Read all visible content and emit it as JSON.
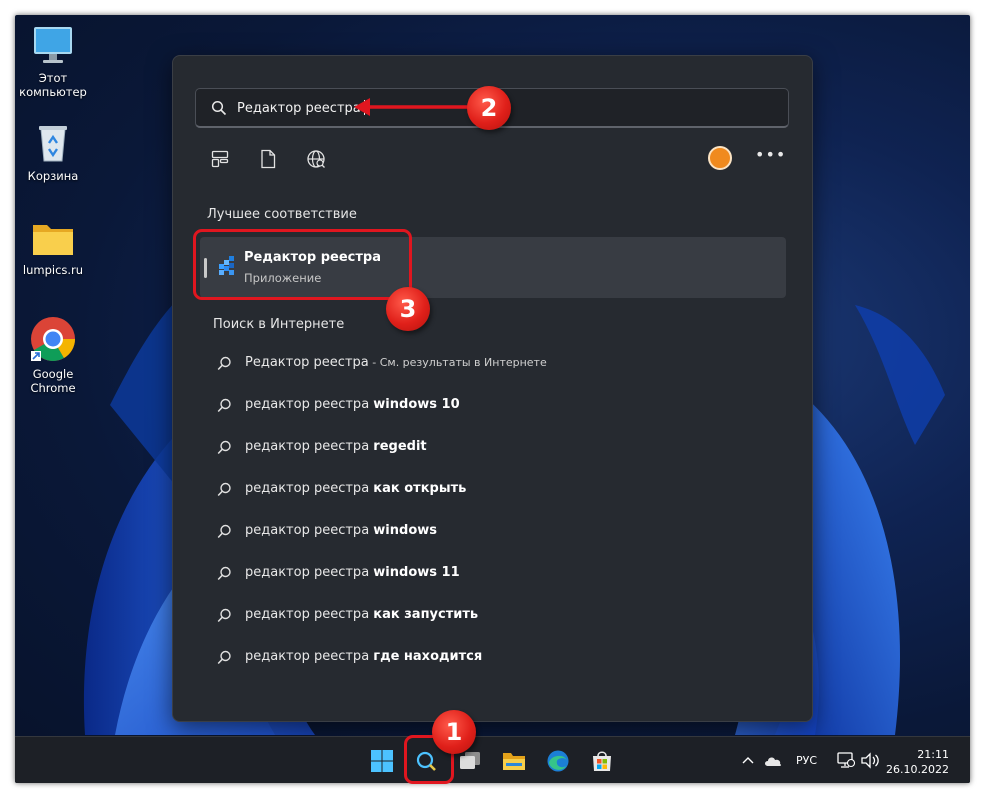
{
  "desktop": {
    "icons": [
      {
        "label_line1": "Этот",
        "label_line2": "компьютер",
        "icon": "monitor-icon"
      },
      {
        "label_line1": "Корзина",
        "label_line2": "",
        "icon": "recycle-bin-icon"
      },
      {
        "label_line1": "lumpics.ru",
        "label_line2": "",
        "icon": "folder-icon"
      },
      {
        "label_line1": "Google",
        "label_line2": "Chrome",
        "icon": "chrome-icon"
      }
    ]
  },
  "search": {
    "query": "Редактор реестра",
    "filters": [
      "apps-filter-icon",
      "documents-filter-icon",
      "web-filter-icon"
    ],
    "more_label": "•••",
    "best_match_title": "Лучшее соответствие",
    "best_match": {
      "name": "Редактор реестра",
      "type": "Приложение"
    },
    "web_title": "Поиск в Интернете",
    "web_results": [
      {
        "prefix": "Редактор реестра",
        "suffix": " - См. результаты в Интернете",
        "suffix_style": "small"
      },
      {
        "prefix": "редактор реестра ",
        "suffix": "windows 10",
        "suffix_style": "bold"
      },
      {
        "prefix": "редактор реестра ",
        "suffix": "regedit",
        "suffix_style": "bold"
      },
      {
        "prefix": "редактор реестра ",
        "suffix": "как открыть",
        "suffix_style": "bold"
      },
      {
        "prefix": "редактор реестра ",
        "suffix": "windows",
        "suffix_style": "bold"
      },
      {
        "prefix": "редактор реестра ",
        "suffix": "windows 11",
        "suffix_style": "bold"
      },
      {
        "prefix": "редактор реестра ",
        "suffix": "как запустить",
        "suffix_style": "bold"
      },
      {
        "prefix": "редактор реестра ",
        "suffix": "где находится",
        "suffix_style": "bold"
      }
    ]
  },
  "callouts": {
    "one": "1",
    "two": "2",
    "three": "3",
    "color": "#e0161f"
  },
  "taskbar": {
    "apps": [
      "start-icon",
      "search-icon",
      "task-view-icon",
      "file-explorer-icon",
      "edge-icon",
      "store-icon"
    ],
    "tray": {
      "language": "РУС",
      "time": "21:11",
      "date": "26.10.2022"
    }
  }
}
